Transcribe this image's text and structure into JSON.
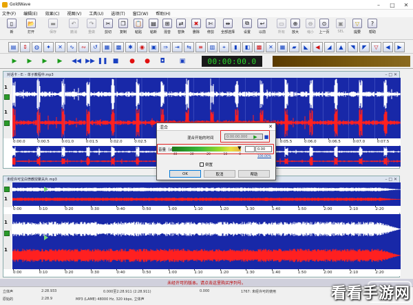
{
  "window": {
    "title": "GoldWave"
  },
  "menu": [
    "文件(F)",
    "编辑(E)",
    "效果(C)",
    "视图(V)",
    "工具(U)",
    "选项(T)",
    "窗口(W)",
    "帮助(H)"
  ],
  "toolbar": [
    {
      "label": "新",
      "icon": "new-icon",
      "disabled": false
    },
    {
      "label": "打开",
      "icon": "open-icon",
      "disabled": false
    },
    {
      "label": "保存",
      "icon": "save-icon",
      "disabled": true
    },
    {
      "label": "撤消",
      "icon": "undo-icon",
      "disabled": true
    },
    {
      "label": "重做",
      "icon": "redo-icon",
      "disabled": true
    },
    {
      "label": "剪切",
      "icon": "cut-icon",
      "disabled": false
    },
    {
      "label": "复制",
      "icon": "copy-icon",
      "disabled": false
    },
    {
      "label": "粘贴",
      "icon": "paste-icon",
      "disabled": false
    },
    {
      "label": "粘新",
      "icon": "paste-new-icon",
      "disabled": false
    },
    {
      "label": "混音",
      "icon": "mix-icon",
      "disabled": false
    },
    {
      "label": "替换",
      "icon": "replace-icon",
      "disabled": false
    },
    {
      "label": "删除",
      "icon": "delete-icon",
      "disabled": false
    },
    {
      "label": "修剪",
      "icon": "trim-icon",
      "disabled": false
    },
    {
      "label": "全部选择",
      "icon": "select-all-icon",
      "disabled": false
    },
    {
      "label": "设置",
      "icon": "set-icon",
      "disabled": false
    },
    {
      "label": "以前",
      "icon": "previous-icon",
      "disabled": false
    },
    {
      "label": "所有",
      "icon": "all-icon",
      "disabled": true
    },
    {
      "label": "放大",
      "icon": "zoom-in-icon",
      "disabled": false
    },
    {
      "label": "缩小",
      "icon": "zoom-out-icon",
      "disabled": true
    },
    {
      "label": "上一页",
      "icon": "prev-page-icon",
      "disabled": false
    },
    {
      "label": "SEL",
      "icon": "sel-icon",
      "disabled": true
    },
    {
      "label": "提要",
      "icon": "cue-icon",
      "disabled": false
    },
    {
      "label": "帮助",
      "icon": "help-icon",
      "disabled": false
    }
  ],
  "transport": {
    "time": "00:00:00.0"
  },
  "doc1": {
    "title": "对话卡 - E: - 单子教程中.mp3",
    "ticks": [
      "0:00.0",
      "0:00.5",
      "0:01.0",
      "0:01.5",
      "0:02.0",
      "0:02.5",
      "0:03.0",
      "0:03.5",
      "0:04.0",
      "0:04.5",
      "0:05.0",
      "0:05.5",
      "0:06.0",
      "0:06.5",
      "0:07.0",
      "0:07.5"
    ]
  },
  "doc2": {
    "title": "未经许可宝白愤教授聚夫片.mp3",
    "ticks_top": [
      "0:00",
      "0:10",
      "0:20",
      "0:30",
      "0:40",
      "0:50",
      "1:00",
      "1:10",
      "1:20",
      "1:30",
      "1:40",
      "1:50",
      "2:00",
      "2:10",
      "2:20"
    ],
    "ticks_bottom": [
      "0:00",
      "0:10",
      "0:20",
      "0:30",
      "0:40",
      "0:50",
      "1:00",
      "1:10",
      "1:20",
      "1:30",
      "1:40",
      "1:50",
      "2:00",
      "2:10",
      "2:20"
    ]
  },
  "dialog": {
    "title": "混合",
    "mix_start_label": "混合开始的时间",
    "mix_start_value": "0:00:00.000",
    "volume_label": "音量（dB）",
    "volume_value": "0.00",
    "volume_percent": "100.00%",
    "scale": [
      "-40",
      "-30",
      "-20",
      "-10",
      "0"
    ],
    "invert_label": "倒置",
    "ok": "OK",
    "cancel": "取消",
    "help": "帮助"
  },
  "status_warning": "未经许可的版本。请点击这里购买序列号。",
  "status": {
    "r1c1": "立体声",
    "r1c2": "2:28.933",
    "r1c3": "0.000至2:28.911 (2:28.911)",
    "r1c4": "0.000",
    "r1c5": "1767: 未经许可的使用",
    "r2c1": "原始的",
    "r2c2": "2:28.9",
    "r2c3": "MP3 (LAME) 48000 Hz, 320 kbps, 立体声"
  },
  "watermark": "看看手游网",
  "colors": {
    "wave_bg": "#1828a8",
    "left_channel": "#ffffff",
    "right_channel": "#ff2020",
    "highlight": "#e02020",
    "timer_text": "#2ad82a"
  }
}
